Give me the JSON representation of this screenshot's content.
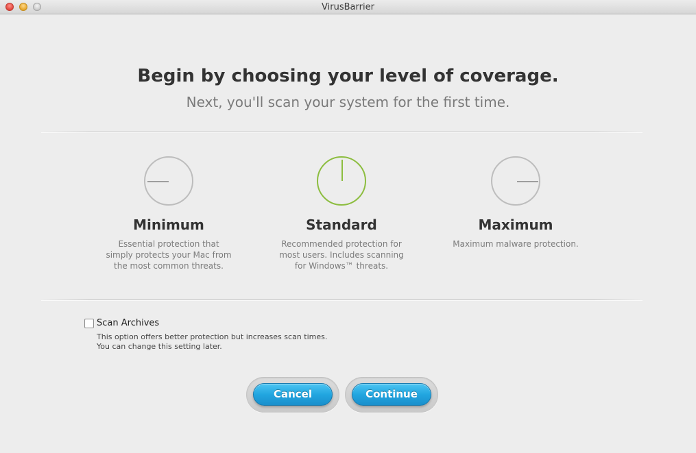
{
  "window": {
    "title": "VirusBarrier"
  },
  "header": {
    "title": "Begin by choosing your level of coverage.",
    "subtitle": "Next, you'll scan your system for the first time."
  },
  "options": [
    {
      "icon": "dial-left-icon",
      "title": "Minimum",
      "description": "Essential protection that simply protects your Mac from the most common threats.",
      "selected": false
    },
    {
      "icon": "dial-up-icon",
      "title": "Standard",
      "description": "Recommended protection for most users. Includes scanning for Windows™ threats.",
      "selected": true
    },
    {
      "icon": "dial-right-icon",
      "title": "Maximum",
      "description": "Maximum malware protection.",
      "selected": false
    }
  ],
  "scan_archives": {
    "label": "Scan Archives",
    "checked": false,
    "help_line1": "This option offers better protection but increases scan times.",
    "help_line2": "You can change this setting later."
  },
  "buttons": {
    "cancel": "Cancel",
    "continue": "Continue"
  },
  "colors": {
    "selected": "#8cbd3f",
    "button": "#22a6e0"
  }
}
